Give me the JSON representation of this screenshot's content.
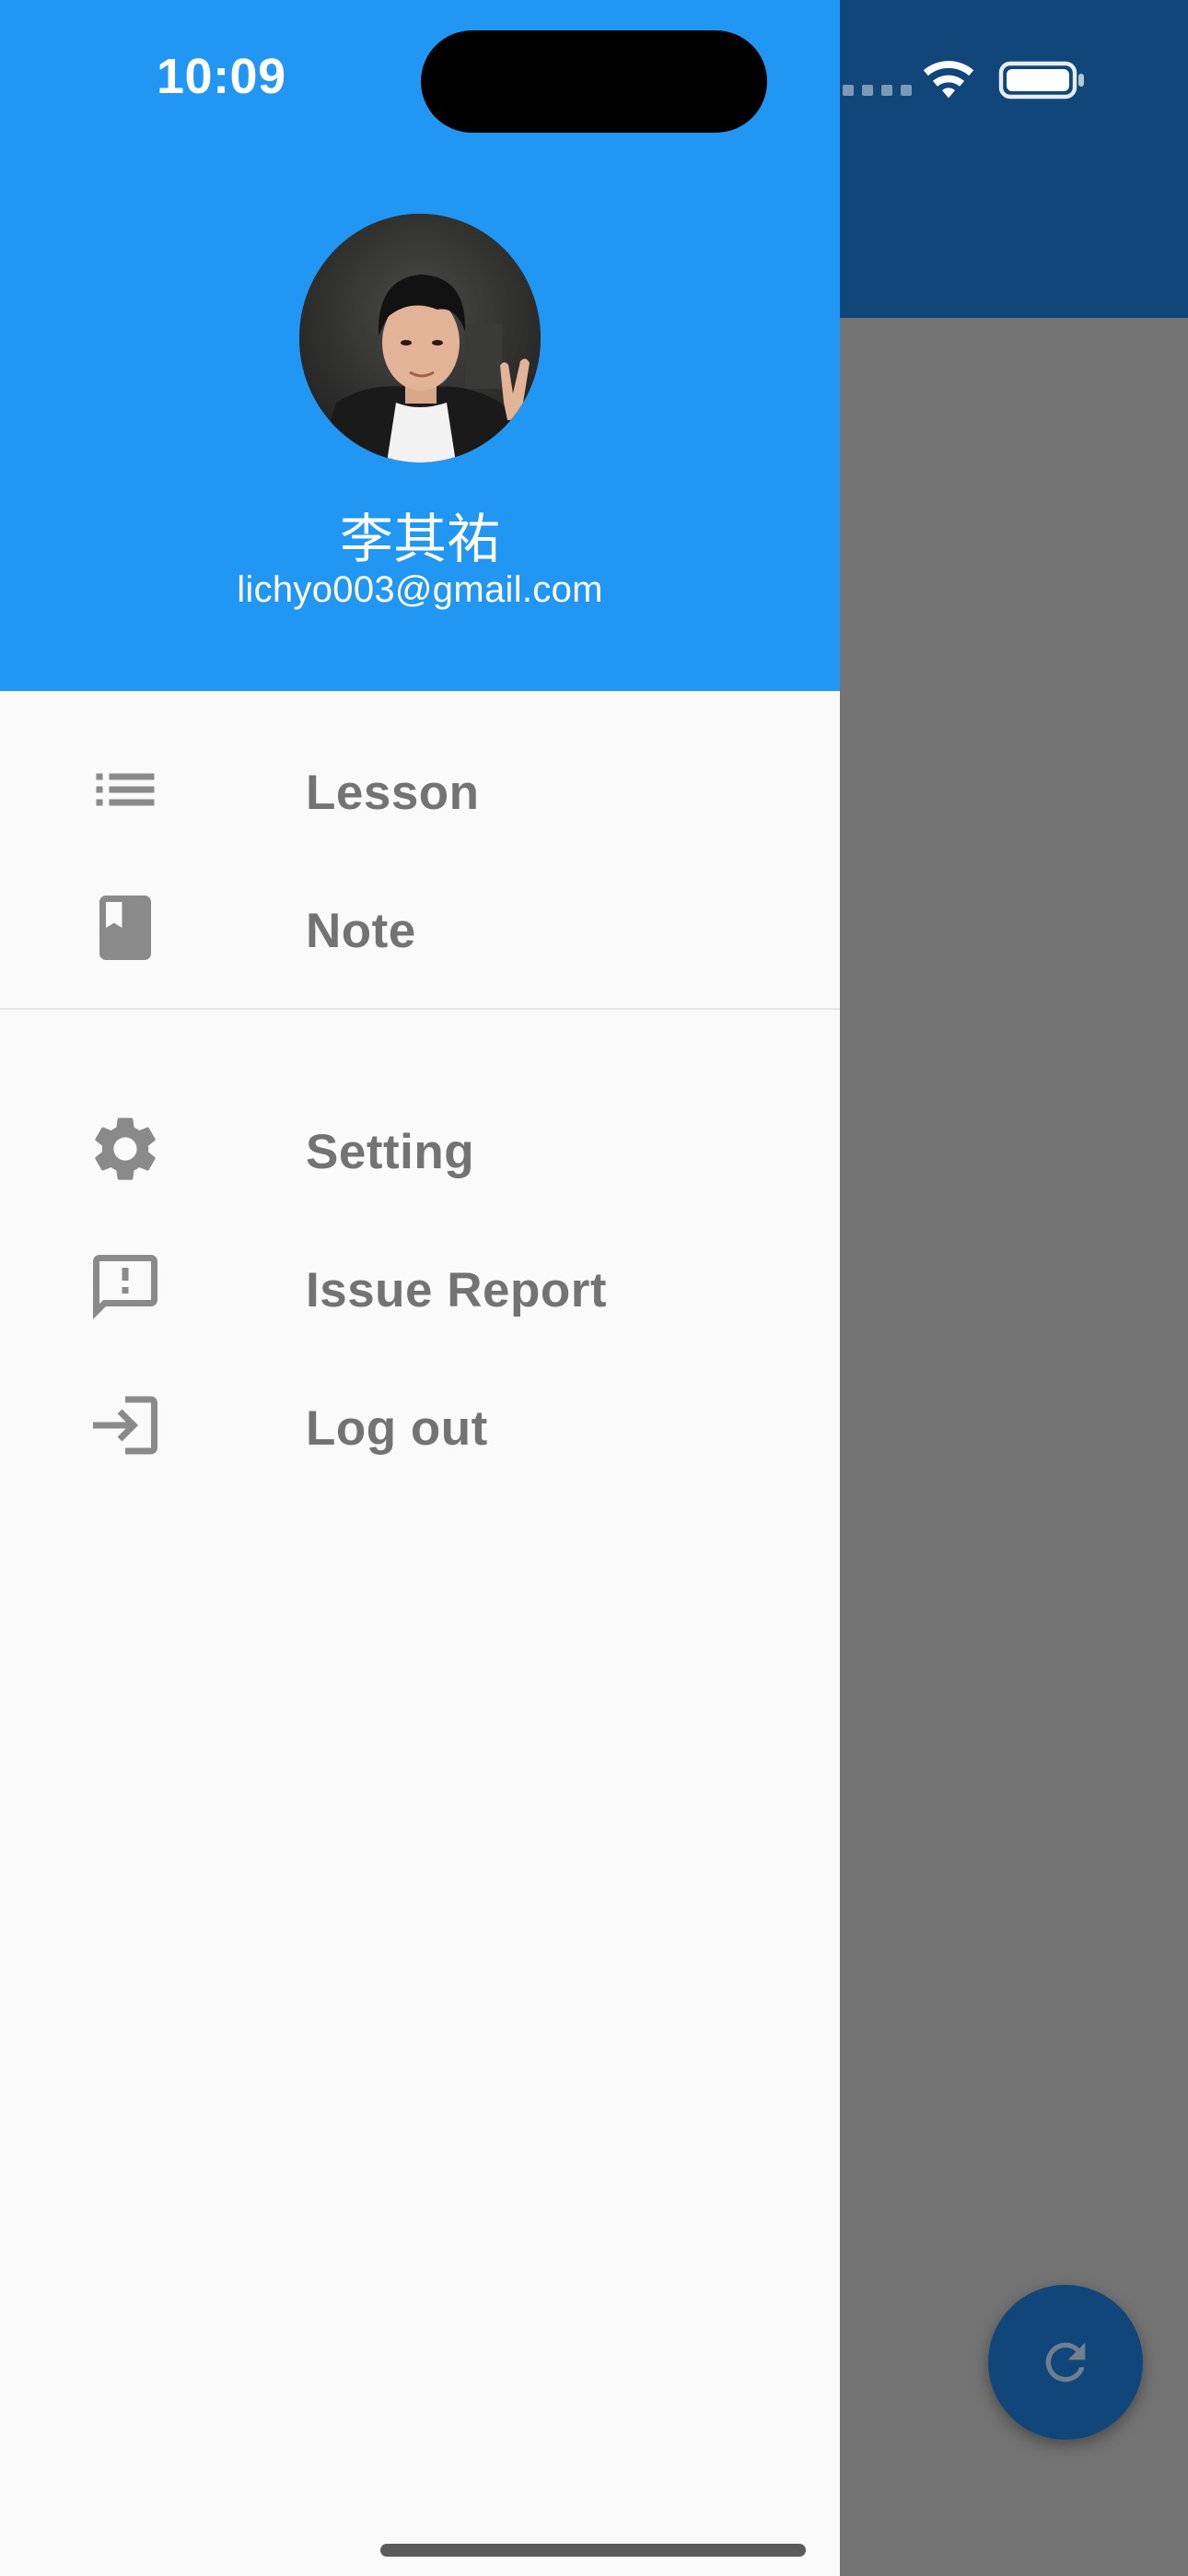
{
  "status_bar": {
    "time": "10:09"
  },
  "drawer": {
    "header": {
      "user_name": "李其祐",
      "user_email": "lichyo003@gmail.com",
      "background_color": "#2196f3"
    },
    "menu_primary": [
      {
        "label": "Lesson",
        "icon": "list-icon"
      },
      {
        "label": "Note",
        "icon": "bookmark-book-icon"
      }
    ],
    "menu_secondary": [
      {
        "label": "Setting",
        "icon": "gear-icon"
      },
      {
        "label": "Issue Report",
        "icon": "feedback-icon"
      },
      {
        "label": "Log out",
        "icon": "login-icon"
      }
    ]
  },
  "background_app": {
    "appbar_color": "#11467a",
    "fab_icon": "refresh-icon"
  },
  "colors": {
    "menu_text": "#737373",
    "menu_icon": "#8a8a8a"
  }
}
